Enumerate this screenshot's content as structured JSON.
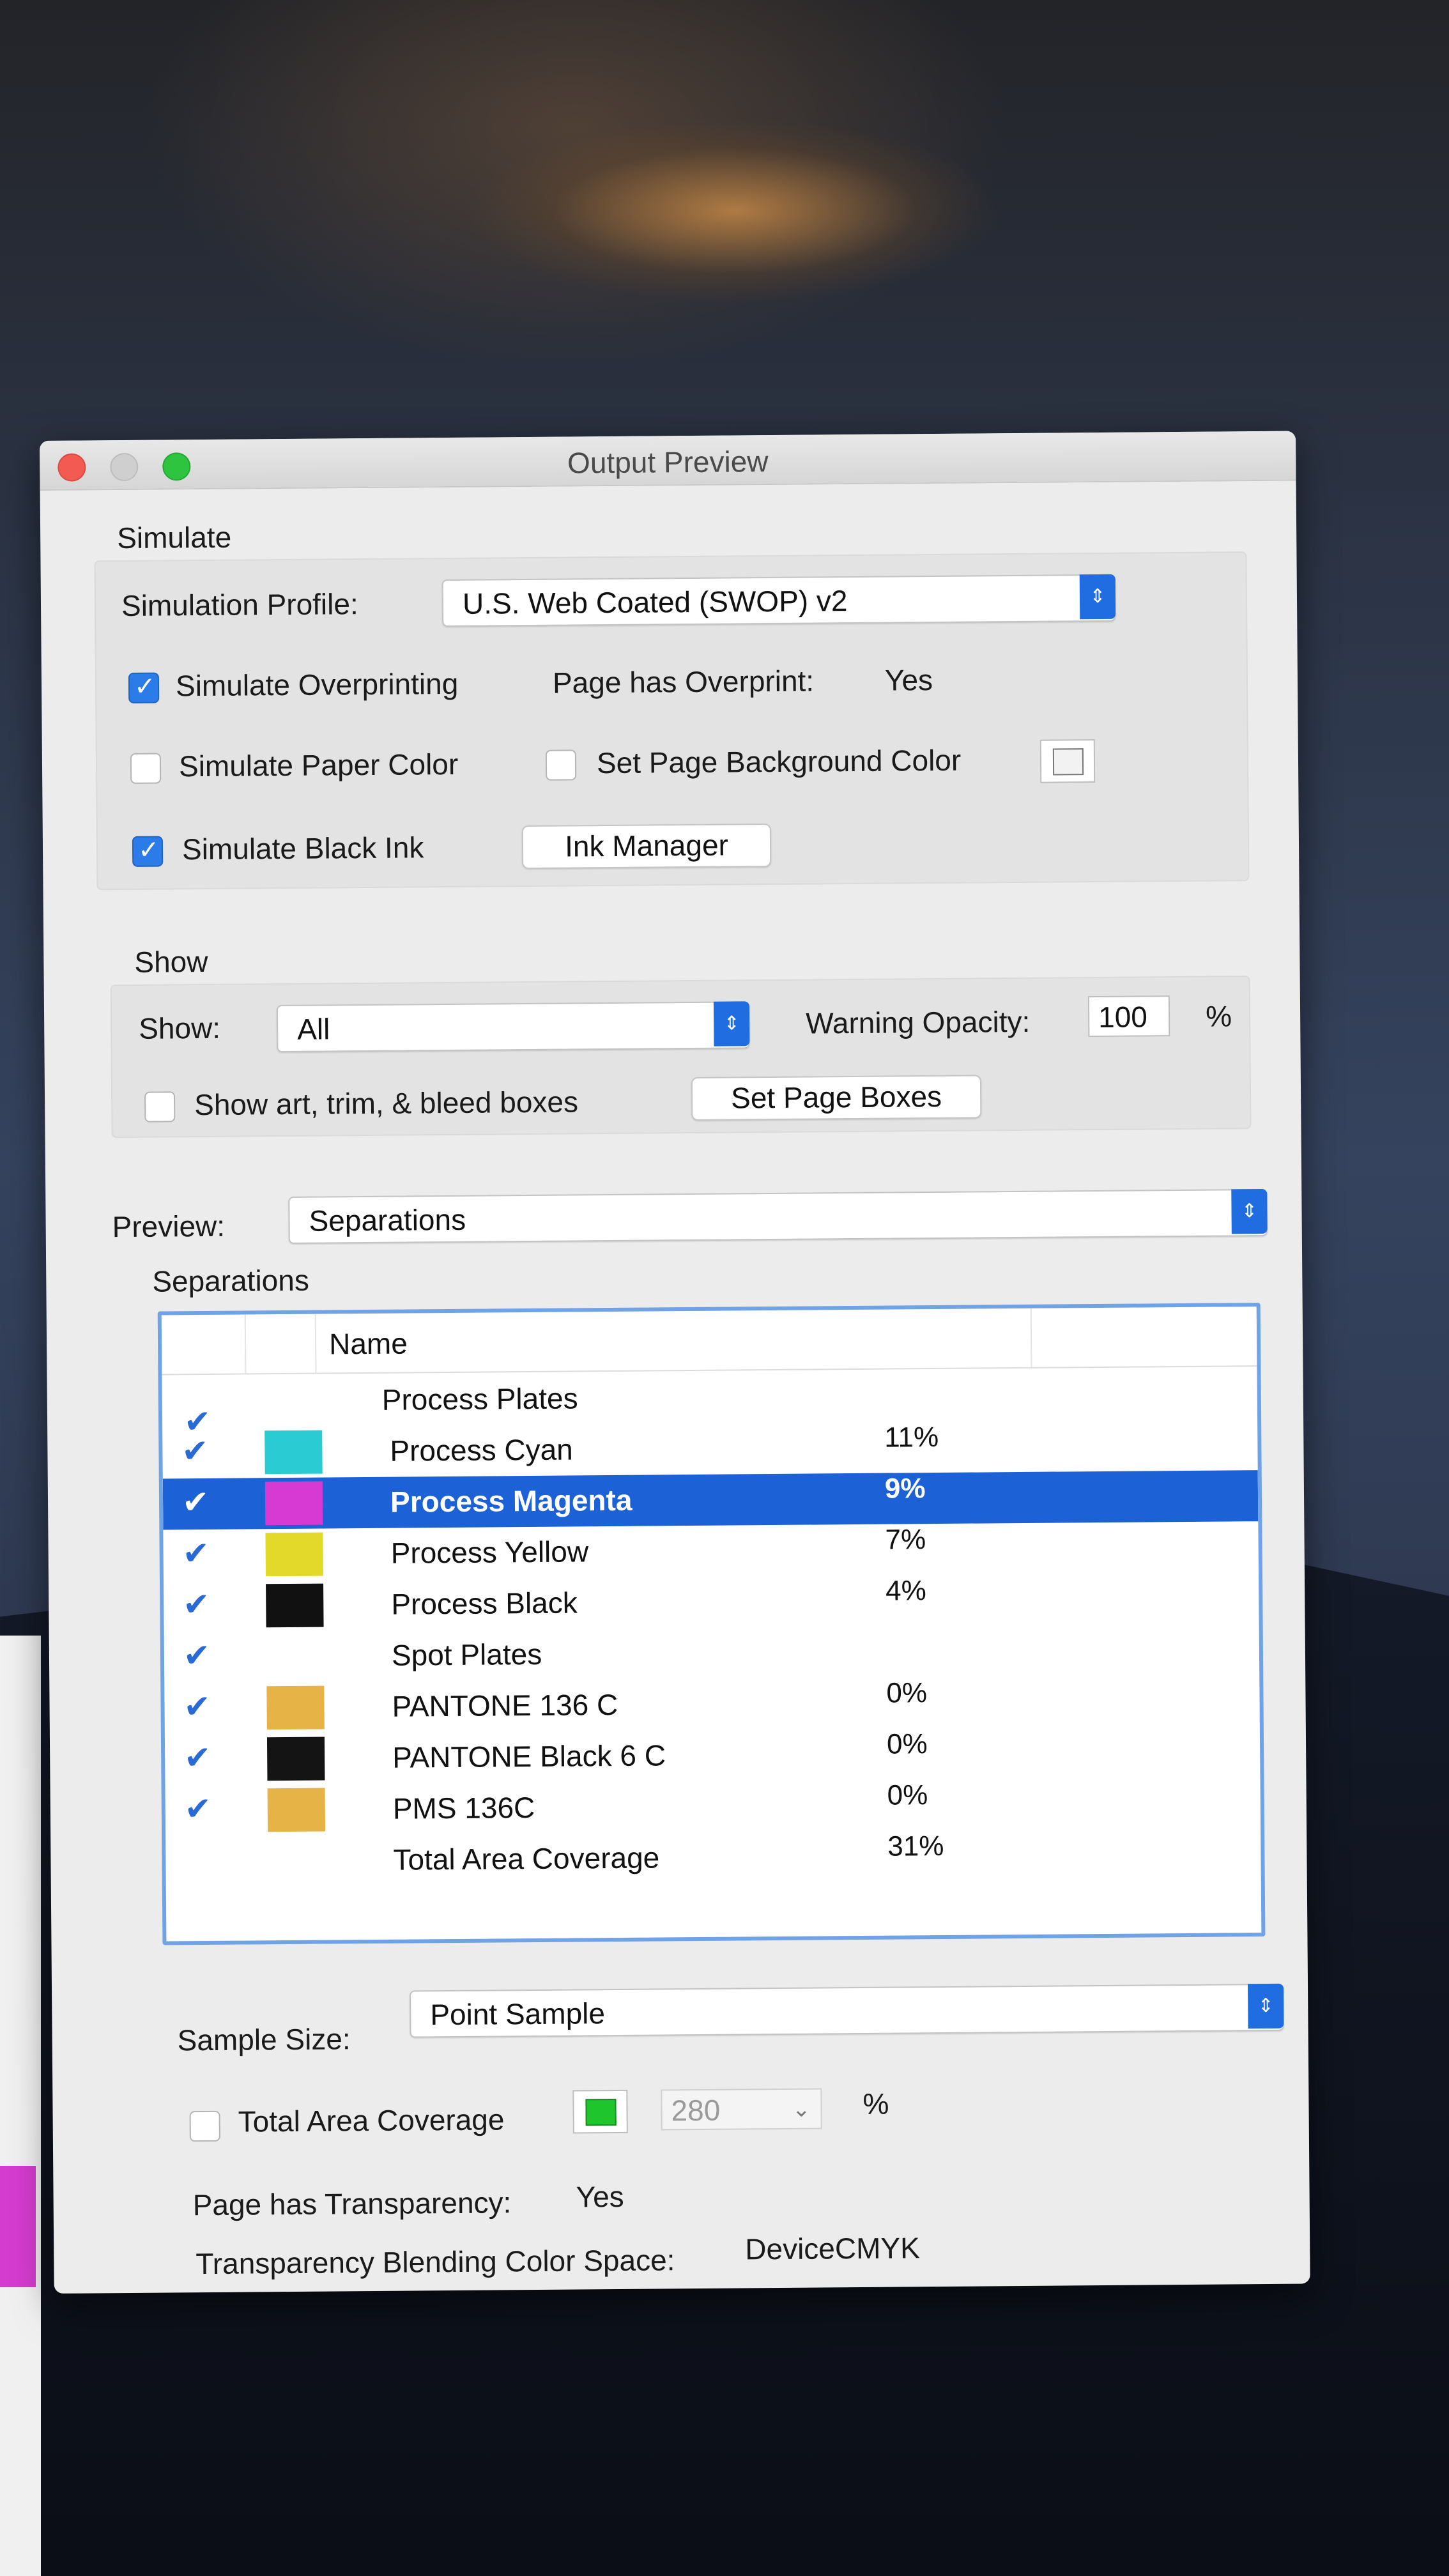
{
  "window": {
    "title": "Output Preview"
  },
  "simulate": {
    "section_label": "Simulate",
    "profile_label": "Simulation Profile:",
    "profile_value": "U.S. Web Coated (SWOP) v2",
    "overprinting_label": "Simulate Overprinting",
    "overprinting_checked": true,
    "page_overprint_label": "Page has Overprint:",
    "page_overprint_value": "Yes",
    "paper_color_label": "Simulate Paper Color",
    "paper_color_checked": false,
    "bg_color_label": "Set Page Background Color",
    "bg_color_checked": false,
    "black_ink_label": "Simulate Black Ink",
    "black_ink_checked": true,
    "ink_manager_label": "Ink Manager"
  },
  "show": {
    "section_label": "Show",
    "show_label": "Show:",
    "show_value": "All",
    "warning_label": "Warning Opacity:",
    "warning_value": "100",
    "warning_unit": "%",
    "boxes_label": "Show art, trim, & bleed boxes",
    "boxes_checked": false,
    "set_boxes_label": "Set Page Boxes"
  },
  "preview": {
    "label": "Preview:",
    "value": "Separations"
  },
  "separations": {
    "section_label": "Separations",
    "column_name": "Name",
    "rows": [
      {
        "name": "Process Plates",
        "pct": "",
        "checked": true,
        "swatch": ""
      },
      {
        "name": "Process Cyan",
        "pct": "11%",
        "checked": true,
        "swatch": "#2bcbd3"
      },
      {
        "name": "Process Magenta",
        "pct": "9%",
        "checked": true,
        "swatch": "#d63ad2",
        "selected": true
      },
      {
        "name": "Process Yellow",
        "pct": "7%",
        "checked": true,
        "swatch": "#e2d92a"
      },
      {
        "name": "Process Black",
        "pct": "4%",
        "checked": true,
        "swatch": "#111111"
      },
      {
        "name": "Spot Plates",
        "pct": "",
        "checked": true,
        "swatch": ""
      },
      {
        "name": "PANTONE 136 C",
        "pct": "0%",
        "checked": true,
        "swatch": "#e6b446"
      },
      {
        "name": "PANTONE Black 6 C",
        "pct": "0%",
        "checked": true,
        "swatch": "#141414"
      },
      {
        "name": "PMS 136C",
        "pct": "0%",
        "checked": true,
        "swatch": "#e6b446"
      },
      {
        "name": "Total Area Coverage",
        "pct": "31%",
        "checked": false,
        "swatch": ""
      }
    ]
  },
  "bottom": {
    "sample_label": "Sample Size:",
    "sample_value": "Point Sample",
    "tac_label": "Total Area Coverage",
    "tac_checked": false,
    "tac_value": "280",
    "tac_unit": "%",
    "transparency_label": "Page has Transparency:",
    "transparency_value": "Yes",
    "blend_label": "Transparency Blending Color Space:",
    "blend_value": "DeviceCMYK"
  },
  "colors": {
    "accent": "#1f6de0",
    "selection": "#1c62d6",
    "tac_swatch": "#1fc52c"
  }
}
